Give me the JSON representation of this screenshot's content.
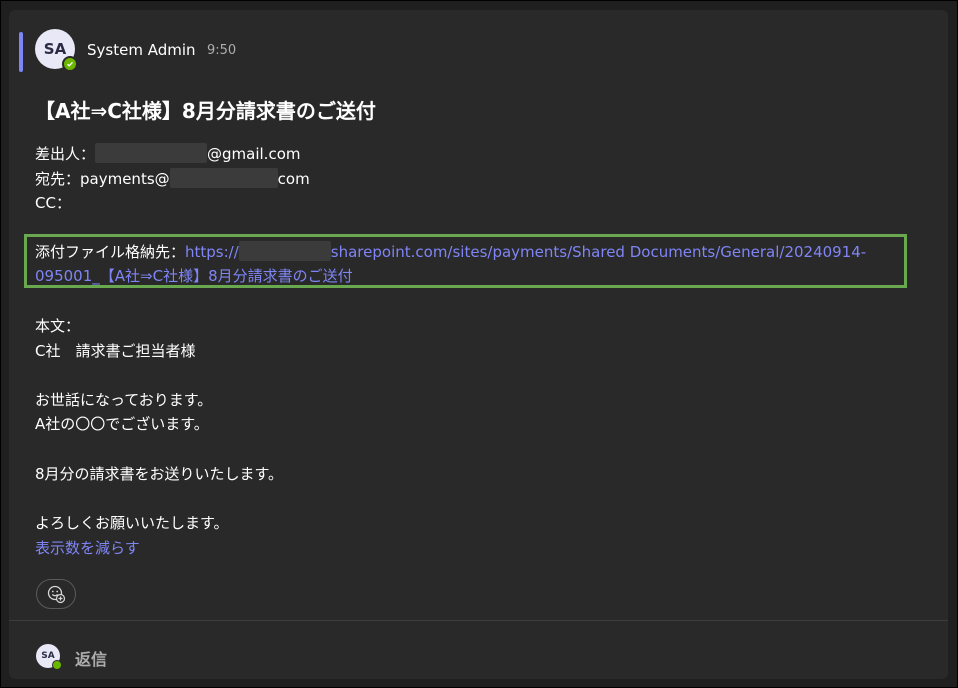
{
  "message": {
    "avatar_initials": "SA",
    "sender": "System Admin",
    "time": "9:50",
    "subject": "【A社⇒C社様】8月分請求書のご送付",
    "from_label": "差出人：",
    "from_suffix": "@gmail.com",
    "to_label": "宛先：payments@",
    "to_suffix": "com",
    "cc_label": "CC：",
    "attachment_label": "添付ファイル格納先：",
    "attachment_link_prefix": "https://",
    "attachment_link_suffix": "sharepoint.com/sites/payments/Shared Documents/General/20240914-095001_【A社⇒C社様】8月分請求書のご送付",
    "body_label": "本文：",
    "body_lines": [
      "C社　請求書ご担当者様",
      "お世話になっております。",
      "A社の〇〇でございます。",
      "8月分の請求書をお送りいたします。",
      "よろしくお願いいたします。"
    ],
    "show_less": "表示数を減らす"
  },
  "reply": {
    "avatar_initials": "SA",
    "label": "返信"
  },
  "icons": {
    "presence": "check-presence-icon",
    "reaction": "add-reaction-icon"
  },
  "colors": {
    "accent": "#7f85f5",
    "presence": "#6bb700",
    "highlight_box": "#6aa84f",
    "card_bg": "#292929"
  }
}
